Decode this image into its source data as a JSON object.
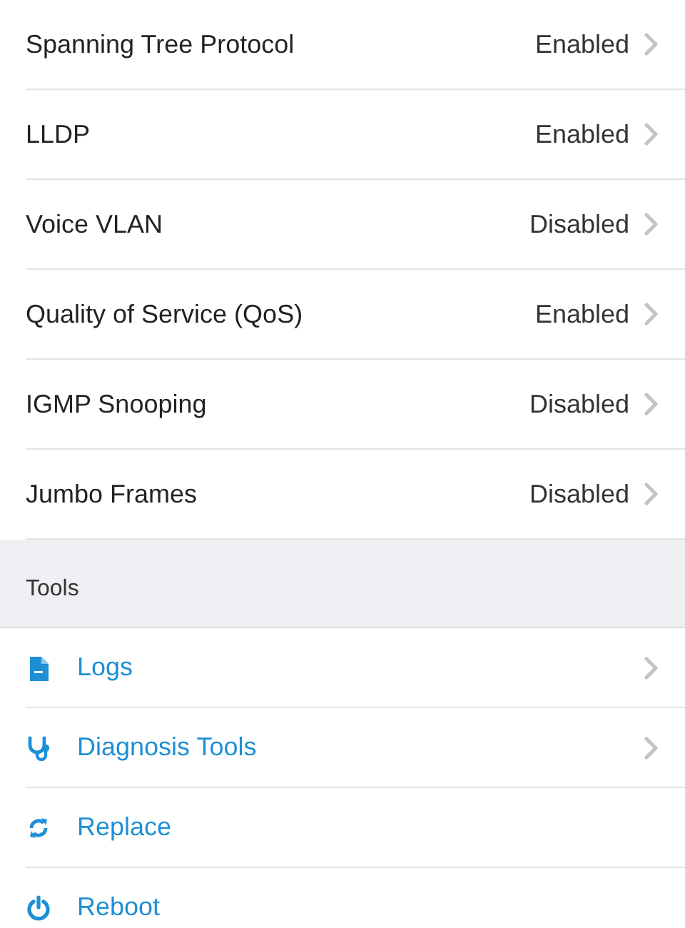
{
  "settings": [
    {
      "label": "Spanning Tree Protocol",
      "value": "Enabled"
    },
    {
      "label": "LLDP",
      "value": "Enabled"
    },
    {
      "label": "Voice VLAN",
      "value": "Disabled"
    },
    {
      "label": "Quality of Service (QoS)",
      "value": "Enabled"
    },
    {
      "label": "IGMP Snooping",
      "value": "Disabled"
    },
    {
      "label": "Jumbo Frames",
      "value": "Disabled"
    }
  ],
  "tools": {
    "header": "Tools",
    "items": [
      {
        "kind": "document",
        "label": "Logs",
        "disclosure": true
      },
      {
        "kind": "stethoscope",
        "label": "Diagnosis Tools",
        "disclosure": true
      },
      {
        "kind": "refresh",
        "label": "Replace",
        "disclosure": false
      },
      {
        "kind": "power",
        "label": "Reboot",
        "disclosure": false
      }
    ]
  }
}
